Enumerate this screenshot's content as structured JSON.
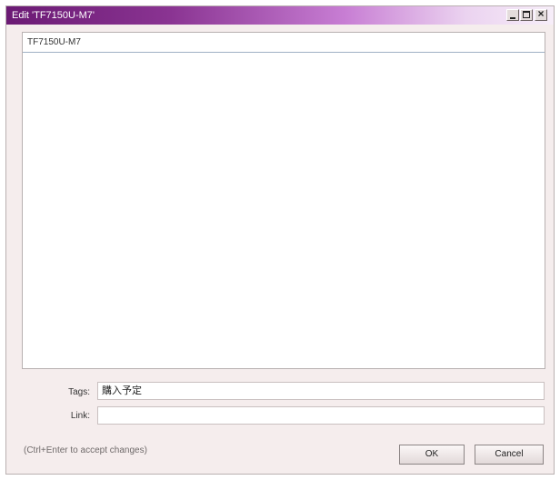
{
  "window": {
    "title": "Edit 'TF7150U-M7'",
    "controls": [
      "minimize-icon",
      "maximize-icon",
      "close-icon"
    ],
    "close_glyph": "×"
  },
  "editor": {
    "name_value": "TF7150U-M7",
    "body_value": ""
  },
  "form": {
    "tags_label": "Tags:",
    "tags_value": "購入予定",
    "link_label": "Link:",
    "link_value": ""
  },
  "footer": {
    "hint": "(Ctrl+Enter to accept changes)",
    "ok_label": "OK",
    "cancel_label": "Cancel"
  },
  "colors": {
    "titlebar_start": "#6b1a74",
    "titlebar_end": "#f7eef9",
    "window_bg": "#f5eded"
  }
}
